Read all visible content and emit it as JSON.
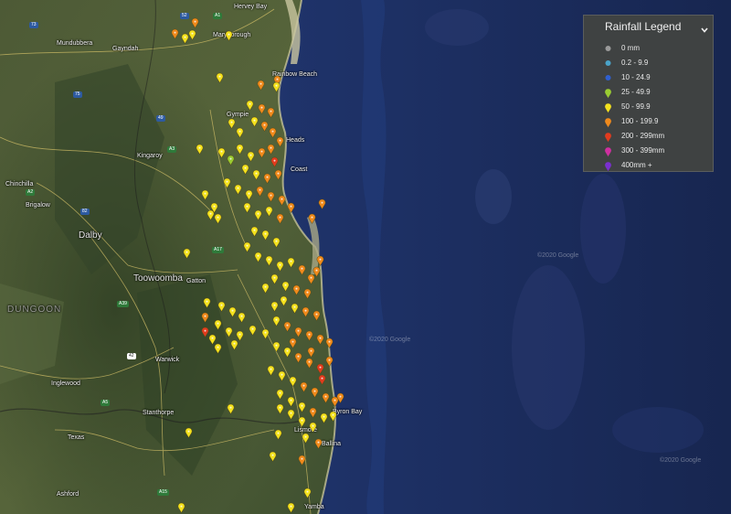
{
  "legend": {
    "title": "Rainfall Legend",
    "items": [
      {
        "label": "0 mm",
        "color": "#9a9a9a",
        "shape": "dot"
      },
      {
        "label": "0.2 - 9.9",
        "color": "#4aa3c9",
        "shape": "dot"
      },
      {
        "label": "10 - 24.9",
        "color": "#2f5fd0",
        "shape": "dot"
      },
      {
        "label": "25 - 49.9",
        "color": "#9acd32",
        "shape": "pin"
      },
      {
        "label": "50 - 99.9",
        "color": "#f4e21e",
        "shape": "pin"
      },
      {
        "label": "100 - 199.9",
        "color": "#f08a1c",
        "shape": "pin"
      },
      {
        "label": "200 - 299mm",
        "color": "#e23b1e",
        "shape": "pin"
      },
      {
        "label": "300 - 399mm",
        "color": "#d02fa0",
        "shape": "pin"
      },
      {
        "label": "400mm +",
        "color": "#7a2fd0",
        "shape": "pin"
      }
    ]
  },
  "places": [
    "Hervey Bay",
    "Maryborough",
    "Mundubbera",
    "Gayndah",
    "Rainbow Beach",
    "Gympie",
    "Heads",
    "Coast",
    "Kingaroy",
    "Chinchilla",
    "Brigalow",
    "Dalby",
    "Toowoomba",
    "Gatton",
    "Warwick",
    "Inglewood",
    "Stanthorpe",
    "Texas",
    "Ashford",
    "Byron Bay",
    "Lismore",
    "Ballina",
    "Yamba"
  ],
  "road_shields": [
    "A1",
    "A3",
    "52",
    "73",
    "75",
    "49",
    "82",
    "A2",
    "A17",
    "A39",
    "A15",
    "42",
    "A5"
  ],
  "watermarks": [
    "©2020 Google",
    "©2020 Google",
    "©2020 Google"
  ],
  "region_label": "DUNGOON",
  "colors": {
    "ocean_shallow": "#2f4d92",
    "ocean_deep": "#1a2a54",
    "land": "#4a5b34",
    "legend_bg": "#3f4242"
  },
  "rainfall_markers": [
    {
      "category": "100 - 199.9"
    },
    {
      "category": "50 - 99.9"
    }
  ]
}
